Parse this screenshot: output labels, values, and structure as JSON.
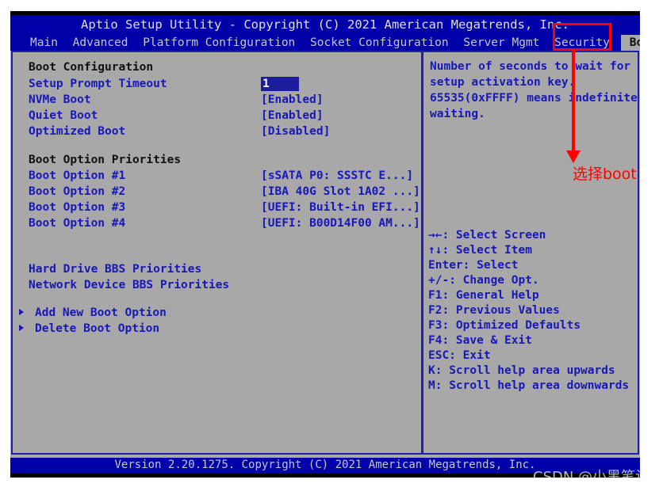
{
  "window": {
    "title": "Aptio Setup Utility - Copyright (C) 2021 American Megatrends, Inc.",
    "footer": "Version 2.20.1275. Copyright (C) 2021 American Megatrends, Inc."
  },
  "menubar": {
    "items": [
      {
        "label": "Main",
        "active": false
      },
      {
        "label": "Advanced",
        "active": false
      },
      {
        "label": "Platform Configuration",
        "active": false
      },
      {
        "label": "Socket Configuration",
        "active": false
      },
      {
        "label": "Server Mgmt",
        "active": false
      },
      {
        "label": "Security",
        "active": false
      },
      {
        "label": "Boot",
        "active": true
      }
    ],
    "more_arrow": "▶"
  },
  "left_panel": {
    "section1_title": "Boot Configuration",
    "section1_rows": [
      {
        "label": "Setup Prompt Timeout",
        "value": "1",
        "selected": true
      },
      {
        "label": "NVMe Boot",
        "value": "[Enabled]",
        "selected": false
      },
      {
        "label": "Quiet Boot",
        "value": "[Enabled]",
        "selected": false
      },
      {
        "label": "Optimized Boot",
        "value": "[Disabled]",
        "selected": false
      }
    ],
    "section2_title": "Boot Option Priorities",
    "section2_rows": [
      {
        "label": "Boot Option #1",
        "value": "[sSATA  P0: SSSTC E...]"
      },
      {
        "label": "Boot Option #2",
        "value": "[IBA 40G Slot 1A02 ...]"
      },
      {
        "label": "Boot Option #3",
        "value": "[UEFI: Built-in EFI...]"
      },
      {
        "label": "Boot Option #4",
        "value": "[UEFI: B00D14F00 AM...]"
      }
    ],
    "bbs_links": [
      "Hard Drive BBS Priorities",
      "Network Device BBS Priorities"
    ],
    "submenu_links": [
      "Add New Boot Option",
      "Delete Boot Option"
    ]
  },
  "right_panel": {
    "help_lines": [
      "Number of seconds to wait for",
      "setup activation key.",
      "65535(0xFFFF) means indefinite",
      "waiting."
    ],
    "key_lines": [
      "→←: Select Screen",
      "↑↓: Select Item",
      "Enter: Select",
      "+/-: Change Opt.",
      "F1: General Help",
      "F2: Previous Values",
      "F3: Optimized Defaults",
      "F4: Save & Exit",
      "ESC: Exit",
      "K: Scroll help area upwards",
      "M: Scroll help area downwards"
    ]
  },
  "annotation": {
    "text": "选择boot",
    "color": "#ff0000"
  },
  "watermark": {
    "text": "CSDN @小黑笔记"
  },
  "colors": {
    "bios_blue": "#0000a8",
    "panel_gray": "#a8a8a8",
    "text_blue": "#1818b8",
    "border_blue": "#2020b0",
    "selected_bg": "#1c1c9c",
    "annotation_red": "#ff0000"
  }
}
